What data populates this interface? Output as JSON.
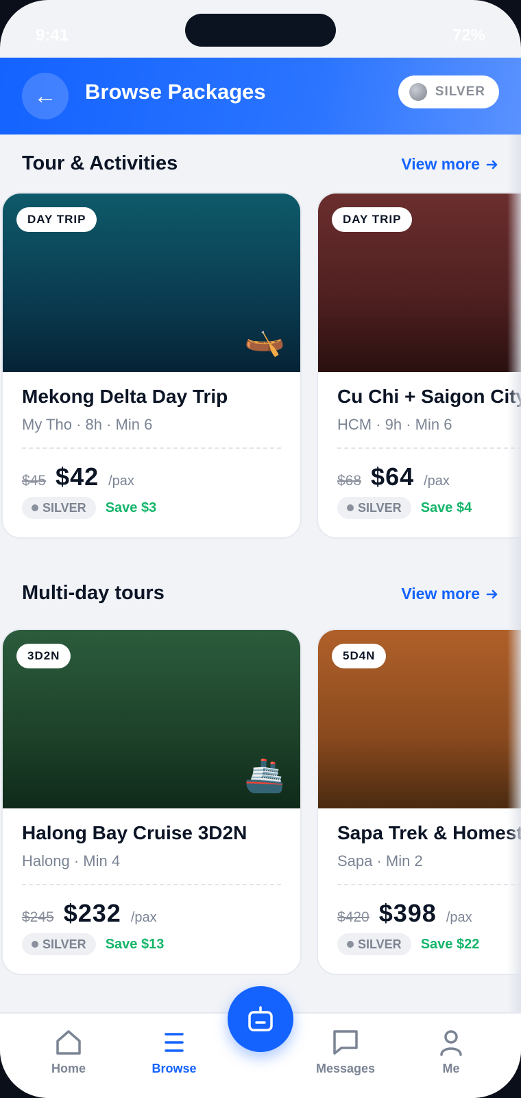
{
  "status": {
    "time": "9:41",
    "battery": "72%"
  },
  "header": {
    "back_icon": "←",
    "title": "Browse Packages",
    "tier": "SILVER"
  },
  "sections": [
    {
      "title": "Tour & Activities",
      "view_more": "View more",
      "cards": [
        {
          "badge": "DAY TRIP",
          "title": "Mekong Delta Day Trip",
          "subtitle": "My Tho · 8h · Min 6",
          "old_price": "$45",
          "price": "$42",
          "unit": "/pax",
          "tier": "SILVER",
          "save": "Save $3",
          "emoji": "🛶",
          "color_top": "#0e5a6a",
          "color_bottom": "#062336"
        },
        {
          "badge": "DAY TRIP",
          "title": "Cu Chi + Saigon City",
          "subtitle": "HCM · 9h · Min 6",
          "old_price": "$68",
          "price": "$64",
          "unit": "/pax",
          "tier": "SILVER",
          "save": "Save $4",
          "emoji": "",
          "color_top": "#6b2e2e",
          "color_bottom": "#2a1010"
        }
      ]
    },
    {
      "title": "Multi-day tours",
      "view_more": "View more",
      "cards": [
        {
          "badge": "3D2N",
          "title": "Halong Bay Cruise 3D2N",
          "subtitle": "Halong · Min 4",
          "old_price": "$245",
          "price": "$232",
          "unit": "/pax",
          "tier": "SILVER",
          "save": "Save $13",
          "emoji": "🚢",
          "color_top": "#2b5c3c",
          "color_bottom": "#0f2a1a"
        },
        {
          "badge": "5D4N",
          "title": "Sapa Trek & Homestay",
          "subtitle": "Sapa · Min 2",
          "old_price": "$420",
          "price": "$398",
          "unit": "/pax",
          "tier": "SILVER",
          "save": "Save $22",
          "emoji": "",
          "color_top": "#b0602a",
          "color_bottom": "#4a2a10"
        }
      ]
    }
  ],
  "tabs": [
    {
      "label": "Home",
      "icon": "home-icon"
    },
    {
      "label": "Browse",
      "icon": "menu-icon"
    },
    {
      "label": "Messages",
      "icon": "message-icon"
    },
    {
      "label": "Me",
      "icon": "user-icon"
    }
  ],
  "fab_icon": "bot-icon",
  "colors": {
    "accent": "#1463ff",
    "save": "#14b56a",
    "text": "#0c1526"
  }
}
